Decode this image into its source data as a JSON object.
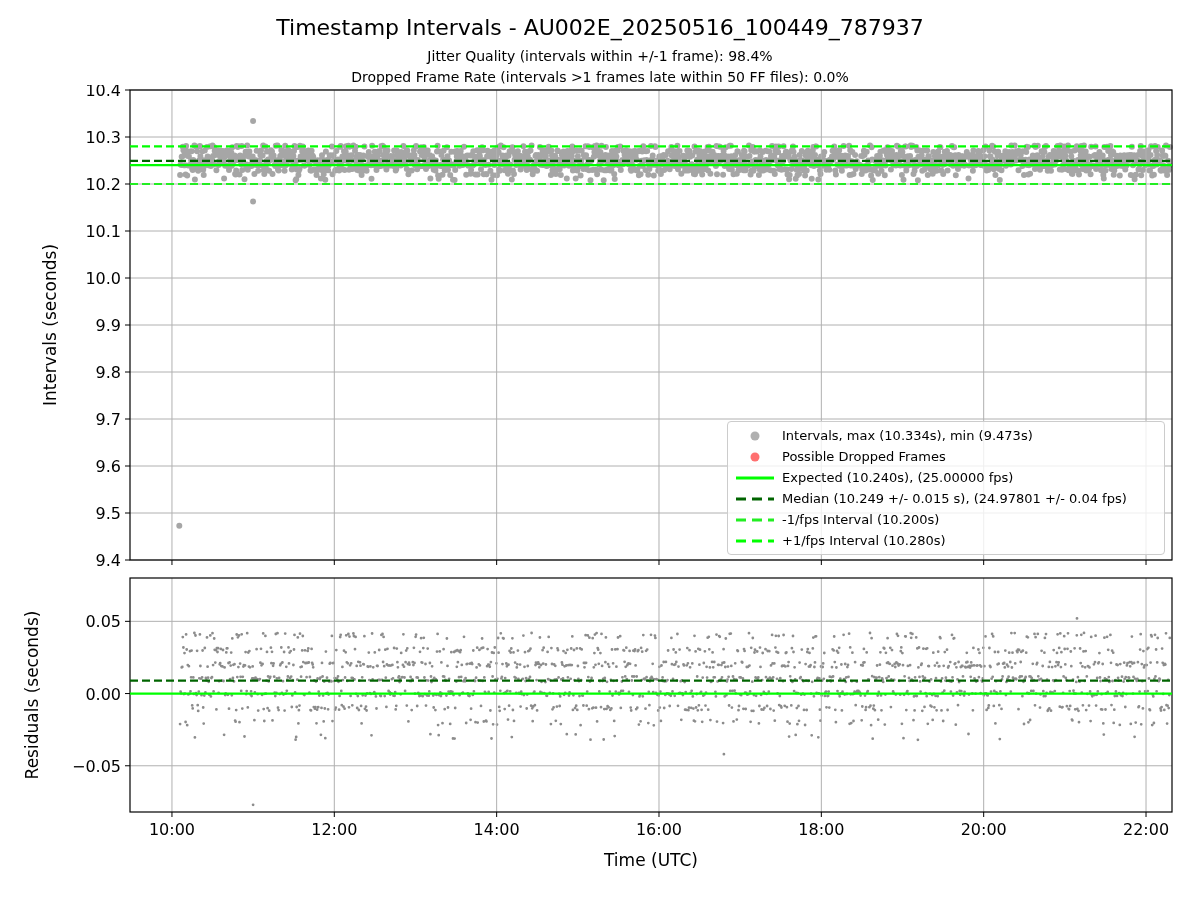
{
  "title": "Timestamp Intervals - AU002E_20250516_100449_787937",
  "subtitles": [
    "Jitter Quality (intervals within +/-1 frame): 98.4%",
    "Dropped Frame Rate (intervals >1 frames late within 50 FF files): 0.0%"
  ],
  "intervals_plot": {
    "legend_markers": [
      {
        "name": "Intervals, max (10.334s), min (9.473s)",
        "color": "#b0b0b0"
      },
      {
        "name": "Possible Dropped Frames",
        "color": "#ff7070"
      }
    ],
    "chart_data": {
      "type": "line",
      "ylabel": "Intervals (seconds)",
      "grid": true,
      "x": [
        9.483,
        22.32
      ],
      "xlim": [
        9.483,
        22.32
      ],
      "ylim": [
        9.4,
        10.4
      ],
      "yticks": [
        {
          "value": 9.4,
          "label": "9.4"
        },
        {
          "value": 9.5,
          "label": "9.5"
        },
        {
          "value": 9.6,
          "label": "9.6"
        },
        {
          "value": 9.7,
          "label": "9.7"
        },
        {
          "value": 9.8,
          "label": "9.8"
        },
        {
          "value": 9.9,
          "label": "9.9"
        },
        {
          "value": 10.0,
          "label": "10.0"
        },
        {
          "value": 10.1,
          "label": "10.1"
        },
        {
          "value": 10.2,
          "label": "10.2"
        },
        {
          "value": 10.3,
          "label": "10.3"
        },
        {
          "value": 10.4,
          "label": "10.4"
        }
      ],
      "series": [
        {
          "name": "Expected (10.240s), (25.00000 fps)",
          "color": "#00ff00",
          "line_style": "solid",
          "values": [
            10.24,
            10.24
          ]
        },
        {
          "name": "Median (10.249 +/- 0.015 s), (24.97801 +/- 0.04 fps)",
          "color": "#006400",
          "line_style": "dashed",
          "values": [
            10.249,
            10.249
          ]
        },
        {
          "name": "-1/fps Interval (10.200s)",
          "color": "#22ee22",
          "line_style": "dashed",
          "values": [
            10.2,
            10.2
          ]
        },
        {
          "name": "+1/fps Interval (10.280s)",
          "color": "#00ff00",
          "line_style": "dashed",
          "values": [
            10.28,
            10.28
          ]
        }
      ]
    }
  },
  "residuals_plot": {
    "chart_data": {
      "type": "line",
      "xlabel": "Time (UTC)",
      "ylabel": "Residuals (seconds)",
      "grid": true,
      "x": [
        9.483,
        22.32
      ],
      "xlim": [
        9.483,
        22.32
      ],
      "ylim": [
        -0.082,
        0.08
      ],
      "xticks": [
        {
          "value": 10,
          "label": "10:00"
        },
        {
          "value": 12,
          "label": "12:00"
        },
        {
          "value": 14,
          "label": "14:00"
        },
        {
          "value": 16,
          "label": "16:00"
        },
        {
          "value": 18,
          "label": "18:00"
        },
        {
          "value": 20,
          "label": "20:00"
        },
        {
          "value": 22,
          "label": "22:00"
        }
      ],
      "yticks": [
        {
          "value": -0.05,
          "label": "−0.05"
        },
        {
          "value": 0,
          "label": "0.00"
        },
        {
          "value": 0.05,
          "label": "0.05"
        }
      ],
      "series": [
        {
          "color": "#00ff00",
          "line_style": "solid",
          "values": [
            0,
            0
          ]
        },
        {
          "color": "#006400",
          "line_style": "dashed",
          "values": [
            0.009,
            0.009
          ]
        }
      ]
    }
  }
}
